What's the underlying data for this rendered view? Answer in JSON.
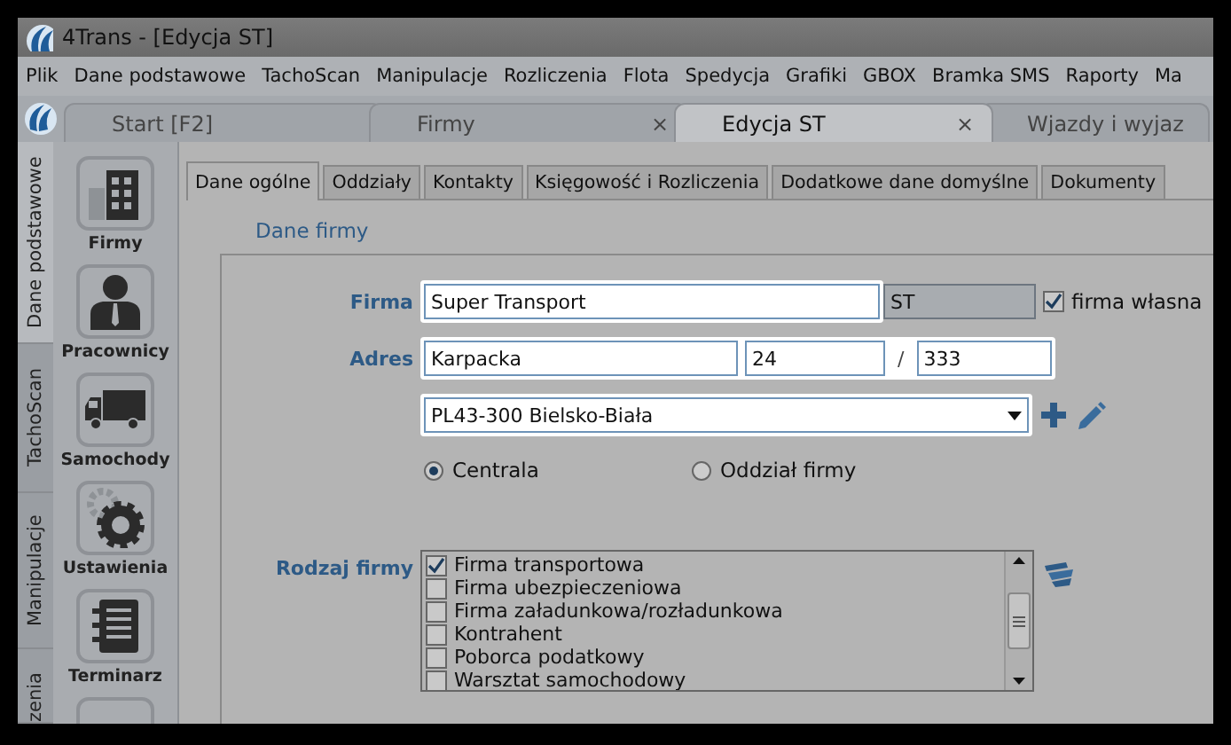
{
  "window": {
    "title": "4Trans - [Edycja ST]"
  },
  "menu": [
    "Plik",
    "Dane podstawowe",
    "TachoScan",
    "Manipulacje",
    "Rozliczenia",
    "Flota",
    "Spedycja",
    "Grafiki",
    "GBOX",
    "Bramka SMS",
    "Raporty",
    "Ma"
  ],
  "doc_tabs": [
    {
      "label": "Start [F2]",
      "selected": false,
      "closable": false
    },
    {
      "label": "Firmy",
      "selected": false,
      "closable": true
    },
    {
      "label": "Edycja ST",
      "selected": true,
      "closable": true
    },
    {
      "label": "Wjazdy i wyjaz",
      "selected": false,
      "closable": false
    }
  ],
  "close_glyph": "×",
  "side_tabs": [
    {
      "label": "Dane podstawowe",
      "selected": true
    },
    {
      "label": "TachoScan",
      "selected": false
    },
    {
      "label": "Manipulacje",
      "selected": false
    },
    {
      "label": "zenia",
      "selected": false
    }
  ],
  "sidebar": [
    {
      "label": "Firmy",
      "kind": "building"
    },
    {
      "label": "Pracownicy",
      "kind": "person"
    },
    {
      "label": "Samochody",
      "kind": "truck"
    },
    {
      "label": "Ustawienia",
      "kind": "gears"
    },
    {
      "label": "Terminarz",
      "kind": "notebook"
    }
  ],
  "form_tabs": [
    {
      "label": "Dane ogólne",
      "selected": true
    },
    {
      "label": "Oddziały",
      "selected": false
    },
    {
      "label": "Kontakty",
      "selected": false
    },
    {
      "label": "Księgowość i Rozliczenia",
      "selected": false
    },
    {
      "label": "Dodatkowe dane domyślne",
      "selected": false
    },
    {
      "label": "Dokumenty",
      "selected": false
    }
  ],
  "section_title": "Dane firmy",
  "firma": {
    "label": "Firma",
    "name": "Super Transport",
    "short": "ST",
    "own_company": {
      "label": "firma własna",
      "checked": true
    }
  },
  "adres": {
    "label": "Adres",
    "street": "Karpacka",
    "number": "24",
    "separator": "/",
    "flat": "333",
    "city": "PL43-300 Bielsko-Biała"
  },
  "branch_type": [
    {
      "label": "Centrala",
      "selected": true
    },
    {
      "label": "Oddział firmy",
      "selected": false
    }
  ],
  "company_type": {
    "label": "Rodzaj firmy",
    "items": [
      {
        "label": "Firma transportowa",
        "checked": true
      },
      {
        "label": "Firma ubezpieczeniowa",
        "checked": false
      },
      {
        "label": "Firma załadunkowa/rozładunkowa",
        "checked": false
      },
      {
        "label": "Kontrahent",
        "checked": false
      },
      {
        "label": "Poborca podatkowy",
        "checked": false
      },
      {
        "label": "Warsztat samochodowy",
        "checked": false
      }
    ]
  }
}
